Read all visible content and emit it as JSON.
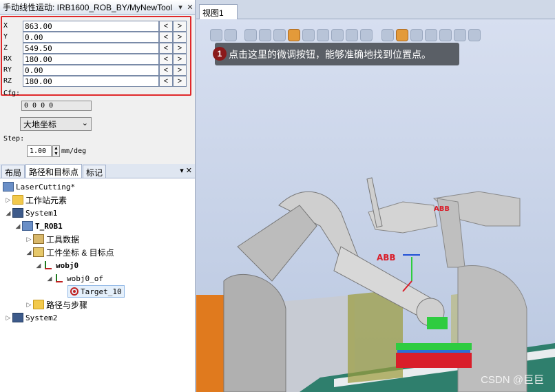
{
  "jog_panel": {
    "title": "手动线性运动: IRB1600_ROB_BY/MyNewTool",
    "rows": [
      {
        "label": "X",
        "value": "863.00"
      },
      {
        "label": "Y",
        "value": "0.00"
      },
      {
        "label": "Z",
        "value": "549.50"
      },
      {
        "label": "RX",
        "value": "180.00"
      },
      {
        "label": "RY",
        "value": "0.00"
      },
      {
        "label": "RZ",
        "value": "180.00"
      }
    ],
    "decrement": "<",
    "increment": ">",
    "cfg_label": "Cfg:",
    "cfg_value": "0 0 0 0",
    "frame_value": "大地坐标",
    "step_label": "Step:",
    "step_value": "1.00",
    "step_unit": "mm/deg"
  },
  "tree_panel": {
    "tabs": [
      "布局",
      "路径和目标点",
      "标记"
    ],
    "items": {
      "station": "LaserCutting*",
      "station_elements": "工作站元素",
      "system1": "System1",
      "t_rob1": "T_ROB1",
      "tool_data": "工具数据",
      "wobj_targets": "工件坐标 & 目标点",
      "wobj0": "wobj0",
      "wobj0_of": "wobj0_of",
      "target": "Target_10",
      "paths": "路径与步骤",
      "system2": "System2"
    }
  },
  "view": {
    "tab_label": "视图1",
    "close": "✕",
    "tooltip_number": "1",
    "tooltip_text": "点击这里的微调按钮，能够准确地找到位置点。",
    "watermark": "CSDN @巨巨",
    "brand": "ABB"
  },
  "colors": {
    "highlight": "#e0282a",
    "accent": "#e39a3a"
  }
}
